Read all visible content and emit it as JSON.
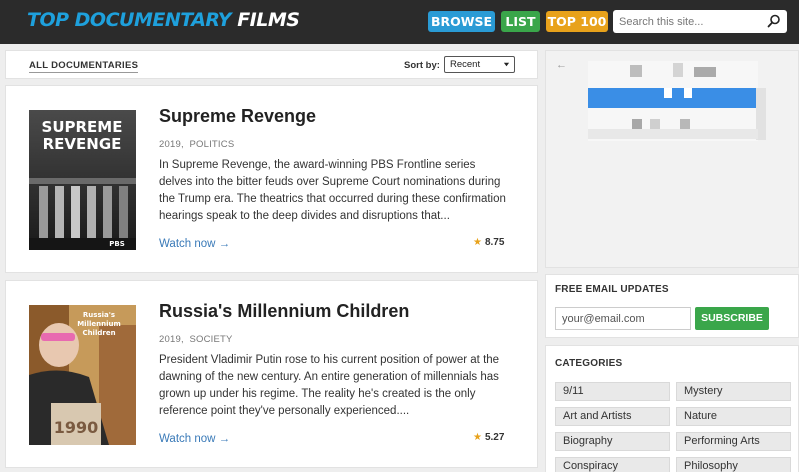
{
  "header": {
    "logo_part1": "Top Documentary",
    "logo_part2": "Films",
    "nav": {
      "browse": "BROWSE",
      "list": "LIST",
      "top100": "TOP 100"
    },
    "search_placeholder": "Search this site..."
  },
  "sortbar": {
    "all_label": "ALL DOCUMENTARIES",
    "sort_label": "Sort by:",
    "sort_value": "Recent"
  },
  "films": [
    {
      "title": "Supreme Revenge",
      "year": "2019",
      "category": "POLITICS",
      "description": "In Supreme Revenge, the award-winning PBS Frontline series delves into the bitter feuds over Supreme Court nominations during the Trump era. The theatrics that occurred during these confirmation hearings speak to the deep divides and disruptions that...",
      "watch_label": "Watch now →",
      "rating": "8.75",
      "poster_title_1": "SUPREME",
      "poster_title_2": "REVENGE",
      "poster_brand": "PBS"
    },
    {
      "title": "Russia's Millennium Children",
      "year": "2019",
      "category": "SOCIETY",
      "description": "President Vladimir Putin rose to his current position of power at the dawning of the new century. An entire generation of millennials has grown up under his regime. The reality he's created is the only reference point they've personally experienced....",
      "watch_label": "Watch now →",
      "rating": "5.27",
      "poster_title_1": "Russia's",
      "poster_title_2": "Millennium",
      "poster_title_3": "Children",
      "poster_shirt": "1990"
    }
  ],
  "ad": {
    "back_glyph": "←"
  },
  "email": {
    "title": "FREE EMAIL UPDATES",
    "placeholder": "your@email.com",
    "button": "SUBSCRIBE"
  },
  "categories": {
    "title": "CATEGORIES",
    "items": [
      "9/11",
      "Mystery",
      "Art and Artists",
      "Nature",
      "Biography",
      "Performing Arts",
      "Conspiracy",
      "Philosophy"
    ]
  },
  "colors": {
    "header_bg": "#2b2b2b",
    "brand_blue": "#1ea0dc",
    "browse": "#2a9bd5",
    "list": "#3aa64a",
    "top100": "#e8a21b",
    "link": "#3a7ab8",
    "star": "#e8a21b"
  }
}
